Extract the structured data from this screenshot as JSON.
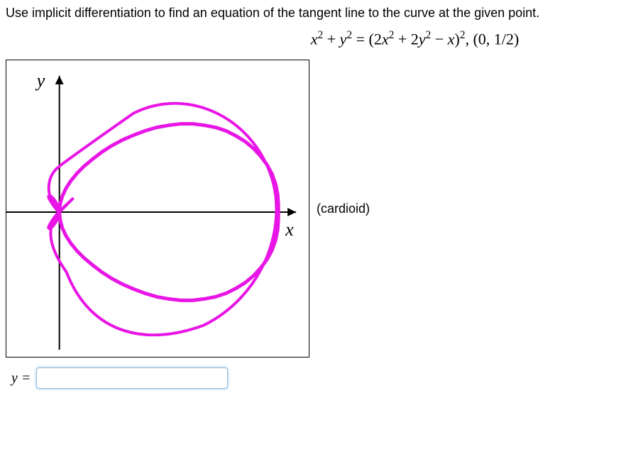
{
  "question": "Use implicit differentiation to find an equation of the tangent line to the curve at the given point.",
  "equation": {
    "lhs_x_var": "x",
    "lhs_x_exp": "2",
    "lhs_plus": " + ",
    "lhs_y_var": "y",
    "lhs_y_exp": "2",
    "equals": " = ",
    "open_paren": "(",
    "rhs_2x_coef": "2",
    "rhs_x_var": "x",
    "rhs_x_exp": "2",
    "rhs_plus": " + ",
    "rhs_2y_coef": "2",
    "rhs_y_var": "y",
    "rhs_y_exp": "2",
    "rhs_minus": " − ",
    "rhs_x_var2": "x",
    "close_paren": ")",
    "outer_exp": "2",
    "comma_space": ",  ",
    "point": "(0, 1/2)"
  },
  "graph": {
    "y_label": "y",
    "x_label": "x",
    "curve_name": "(cardioid)"
  },
  "answer": {
    "label": "y =",
    "value": ""
  }
}
